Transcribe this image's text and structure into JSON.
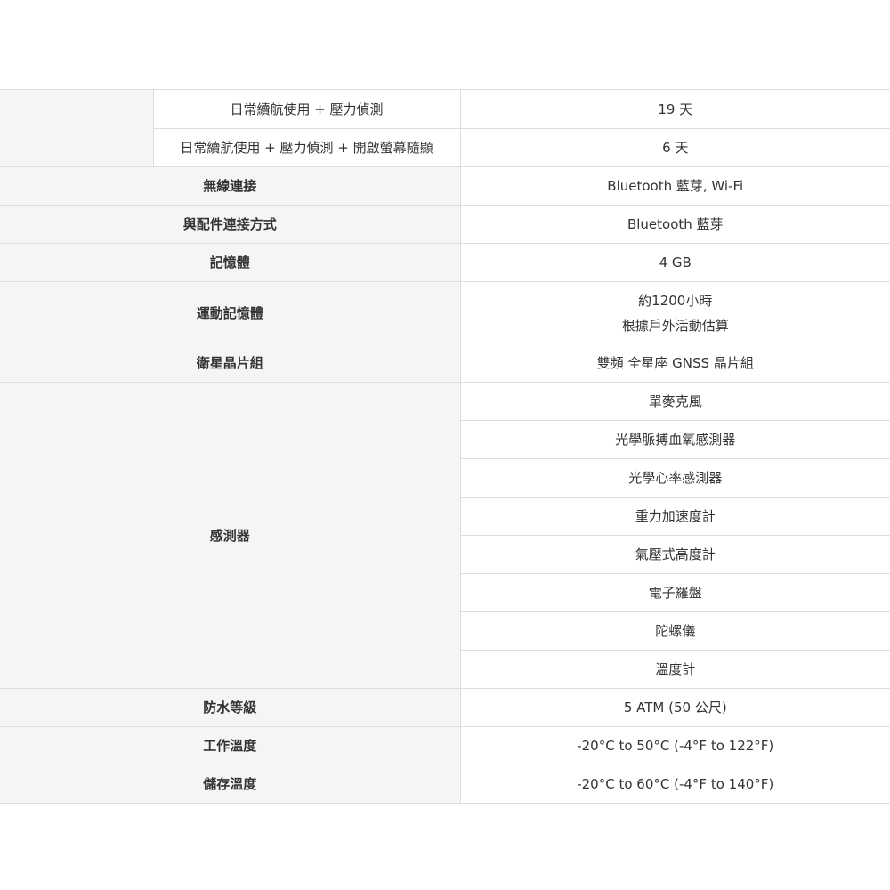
{
  "battery": {
    "rows": [
      {
        "label": "日常續航使用 + 壓力偵測",
        "value": "19 天"
      },
      {
        "label": "日常續航使用 + 壓力偵測 + 開啟螢幕隨顯",
        "value": "6 天"
      }
    ]
  },
  "wireless": {
    "label": "無線連接",
    "value": "Bluetooth 藍芽, Wi-Fi"
  },
  "accessory": {
    "label": "與配件連接方式",
    "value": "Bluetooth 藍芽"
  },
  "memory": {
    "label": "記憶體",
    "value": "4 GB"
  },
  "activity_memory": {
    "label": "運動記憶體",
    "value_line1": "約1200小時",
    "value_line2": "根據戶外活動估算"
  },
  "chipset": {
    "label": "衛星晶片組",
    "value": "雙頻 全星座 GNSS 晶片組"
  },
  "sensors": {
    "label": "感測器",
    "items": [
      "單麥克風",
      "光學脈搏血氧感測器",
      "光學心率感測器",
      "重力加速度計",
      "氣壓式高度計",
      "電子羅盤",
      "陀螺儀",
      "溫度計"
    ]
  },
  "waterproof": {
    "label": "防水等級",
    "value": "5 ATM (50 公尺)"
  },
  "operating_temp": {
    "label": "工作溫度",
    "value": "-20°C to 50°C (-4°F to 122°F)"
  },
  "storage_temp": {
    "label": "儲存溫度",
    "value": "-20°C to 60°C (-4°F to 140°F)"
  }
}
